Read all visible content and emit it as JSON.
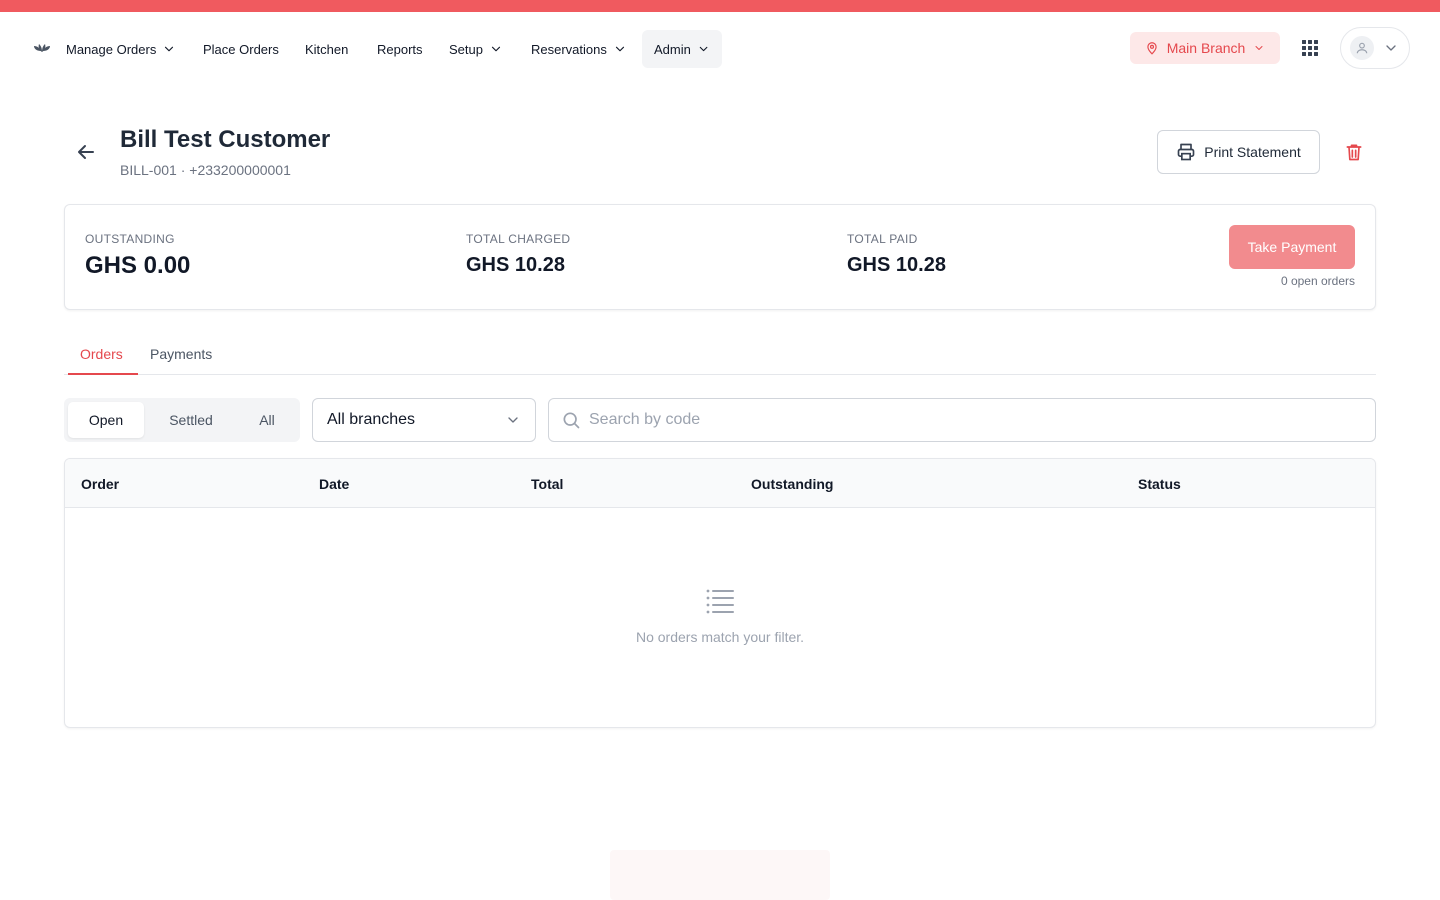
{
  "colors": {
    "accent": "#f05a5f",
    "accent_text": "#e5484d",
    "accent_soft": "#fde8e8",
    "pay_button": "#f28b8e"
  },
  "nav": {
    "items": [
      {
        "label": "Manage Orders",
        "dropdown": true
      },
      {
        "label": "Place Orders",
        "dropdown": false
      },
      {
        "label": "Kitchen",
        "dropdown": false
      },
      {
        "label": "Reports",
        "dropdown": false
      },
      {
        "label": "Setup",
        "dropdown": true
      },
      {
        "label": "Reservations",
        "dropdown": true
      },
      {
        "label": "Admin",
        "dropdown": true,
        "active": true
      }
    ],
    "branch": "Main Branch",
    "icons": [
      "logo-icon",
      "location-pin-icon",
      "apps-grid-icon",
      "user-icon",
      "chevron-down-icon"
    ]
  },
  "header": {
    "title": "Bill Test Customer",
    "subtitle": "BILL-001 · +233200000001",
    "print_label": "Print Statement"
  },
  "summary": {
    "outstanding_label": "OUTSTANDING",
    "outstanding_value": "GHS 0.00",
    "charged_label": "TOTAL CHARGED",
    "charged_value": "GHS 10.28",
    "paid_label": "TOTAL PAID",
    "paid_value": "GHS 10.28",
    "pay_label": "Take Payment",
    "open_orders": "0 open orders"
  },
  "tabs": [
    {
      "label": "Orders",
      "active": true
    },
    {
      "label": "Payments",
      "active": false
    }
  ],
  "filters": {
    "segments": [
      {
        "label": "Open",
        "active": true
      },
      {
        "label": "Settled",
        "active": false
      },
      {
        "label": "All",
        "active": false
      }
    ],
    "branch_select": "All branches",
    "search_placeholder": "Search by code",
    "search_value": ""
  },
  "table": {
    "columns": [
      "Order",
      "Date",
      "Total",
      "Outstanding",
      "Status"
    ],
    "rows": [],
    "empty_text": "No orders match your filter."
  }
}
